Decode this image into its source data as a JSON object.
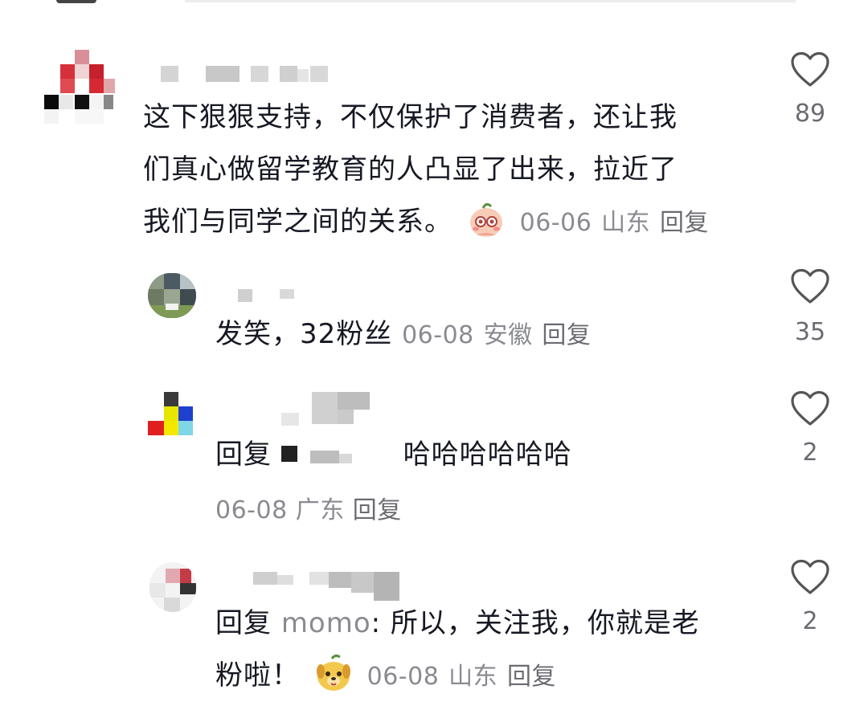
{
  "comments": [
    {
      "text_lines": [
        "这下狠狠支持，不仅保护了消费者，还让我",
        "们真心做留学教育的人凸显了出来，拉近了",
        "我们与同学之间的关系。"
      ],
      "emoji": "blush-face-emoji",
      "date": "06-06",
      "location": "山东",
      "reply_label": "回复",
      "likes": "89"
    },
    {
      "text": "发笑，32粉丝",
      "date": "06-08",
      "location": "安徽",
      "reply_label": "回复",
      "likes": "35"
    },
    {
      "reply_prefix": "回复",
      "text": "哈哈哈哈哈哈",
      "date": "06-08",
      "location": "广东",
      "reply_label": "回复",
      "likes": "2"
    },
    {
      "reply_prefix": "回复",
      "mention": "momo",
      "colon": ":",
      "text_line1": " 所以，关注我，你就是老",
      "text_line2": "粉啦！",
      "emoji": "dog-face-emoji",
      "date": "06-08",
      "location": "山东",
      "reply_label": "回复",
      "likes": "2"
    }
  ],
  "colors": {
    "text": "#161823",
    "meta": "#8a8b91",
    "icon": "#555555"
  }
}
